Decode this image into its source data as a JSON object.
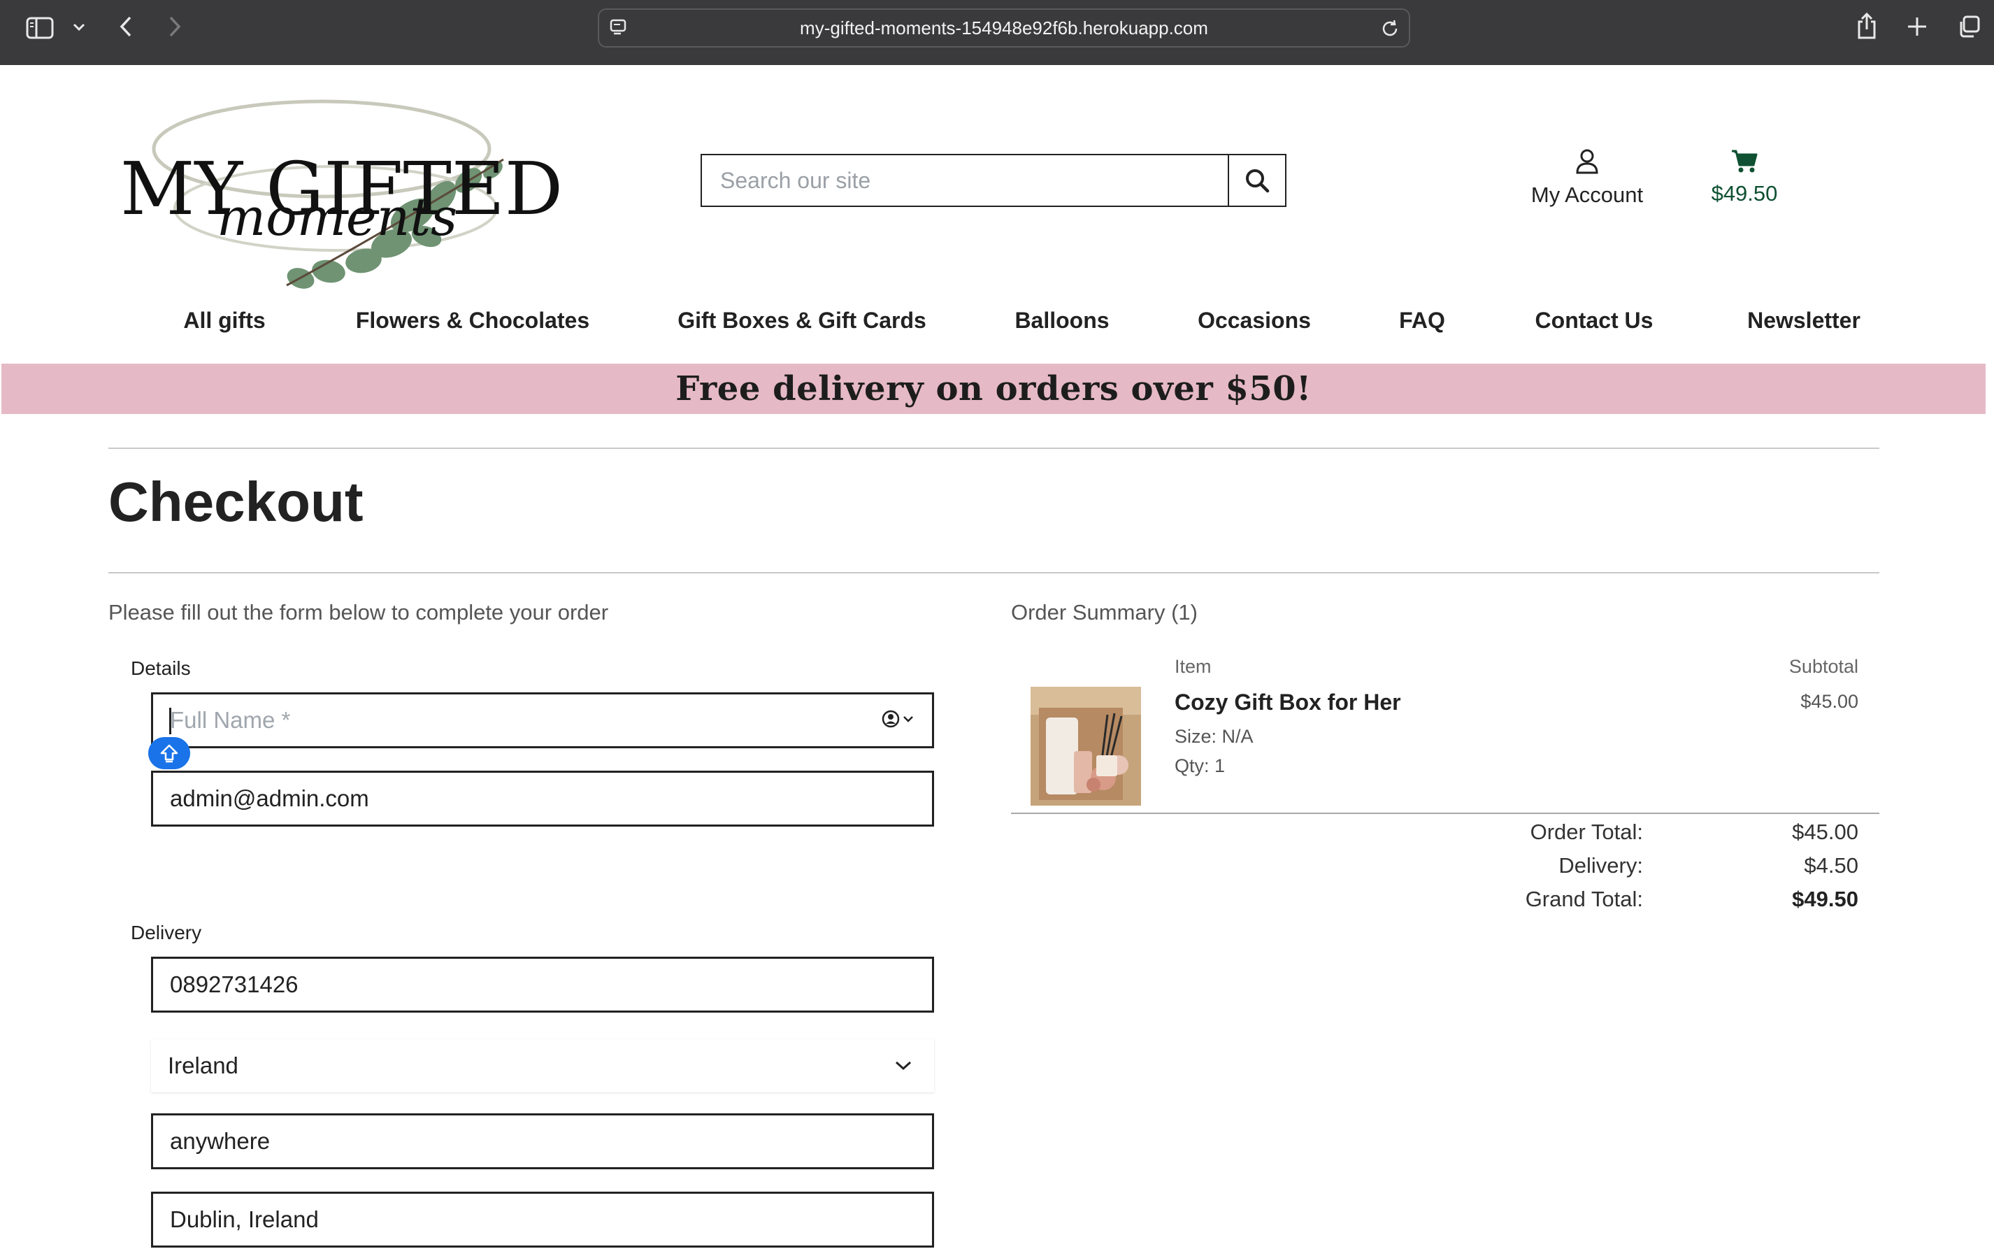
{
  "browser": {
    "url": "my-gifted-moments-154948e92f6b.herokuapp.com"
  },
  "header": {
    "logo": {
      "line1": "MY GIFTED",
      "line2": "moments"
    },
    "search_placeholder": "Search our site",
    "account_label": "My Account",
    "cart_total": "$49.50"
  },
  "nav": {
    "items": [
      "All gifts",
      "Flowers & Chocolates",
      "Gift Boxes & Gift Cards",
      "Balloons",
      "Occasions",
      "FAQ",
      "Contact Us",
      "Newsletter"
    ]
  },
  "banner": {
    "text": "Free delivery on orders over $50!"
  },
  "page": {
    "title": "Checkout"
  },
  "form": {
    "intro": "Please fill out the form below to complete your order",
    "details_label": "Details",
    "full_name_placeholder": "Full Name *",
    "full_name_value": "",
    "email_value": "admin@admin.com",
    "delivery_label": "Delivery",
    "phone_value": "0892731426",
    "country_value": "Ireland",
    "address_value": "anywhere",
    "town_value": "Dublin, Ireland"
  },
  "summary": {
    "title": "Order Summary (1)",
    "item_header": "Item",
    "subtotal_header": "Subtotal",
    "item": {
      "name": "Cozy Gift Box for Her",
      "size": "Size: N/A",
      "qty": "Qty: 1",
      "subtotal": "$45.00"
    },
    "order_total_label": "Order Total:",
    "order_total_value": "$45.00",
    "delivery_label": "Delivery:",
    "delivery_value": "$4.50",
    "grand_total_label": "Grand Total:",
    "grand_total_value": "$49.50"
  },
  "colors": {
    "banner_bg": "#e6b9c6",
    "cart_green": "#0f5132",
    "autofill_blue": "#1a73e8"
  }
}
